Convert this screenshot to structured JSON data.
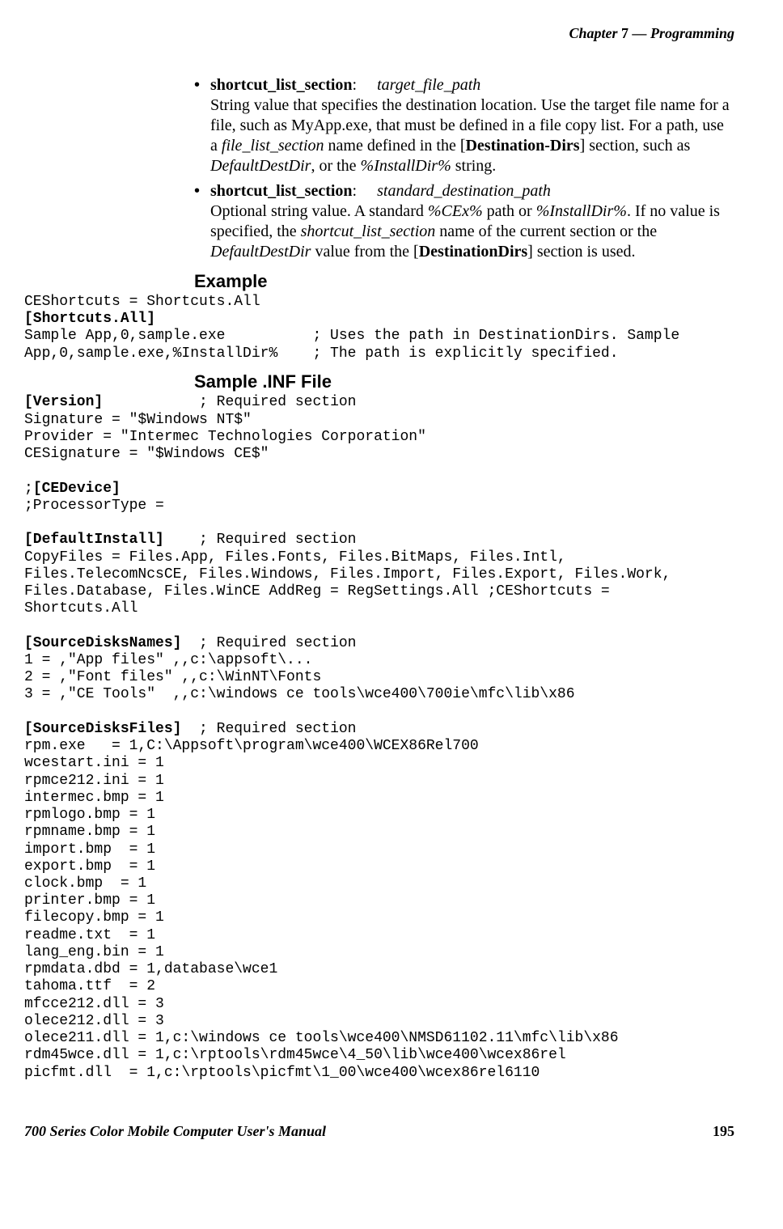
{
  "header": {
    "chapter_label": "Chapter",
    "chapter_num": "7",
    "dash": "—",
    "chapter_title": "Programming"
  },
  "bullets": [
    {
      "term": "shortcut_list_section",
      "colon": ":",
      "arg": "target_file_path",
      "body_parts": [
        {
          "t": "String value that specifies the destination location. Use the target file name for a file, such as MyApp.exe, that must be defined in a file copy list. For a path, use a ",
          "cls": ""
        },
        {
          "t": "file_list_section",
          "cls": "i"
        },
        {
          "t": " name defined in the [",
          "cls": ""
        },
        {
          "t": "Destination-Dirs",
          "cls": "b"
        },
        {
          "t": "] section, such as ",
          "cls": ""
        },
        {
          "t": "DefaultDestDir",
          "cls": "i"
        },
        {
          "t": ", or the ",
          "cls": ""
        },
        {
          "t": "%InstallDir%",
          "cls": "i"
        },
        {
          "t": " string.",
          "cls": ""
        }
      ]
    },
    {
      "term": "shortcut_list_section",
      "colon": ":",
      "arg": "standard_destination_path",
      "body_parts": [
        {
          "t": "Optional string value. A standard ",
          "cls": ""
        },
        {
          "t": "%CEx%",
          "cls": "i"
        },
        {
          "t": " path or ",
          "cls": ""
        },
        {
          "t": "%InstallDir%",
          "cls": "i"
        },
        {
          "t": ". If no value is specified, the ",
          "cls": ""
        },
        {
          "t": "shortcut_list_section",
          "cls": "i"
        },
        {
          "t": " name of the current section or the ",
          "cls": ""
        },
        {
          "t": "DefaultDestDir",
          "cls": "i"
        },
        {
          "t": " value from the [",
          "cls": ""
        },
        {
          "t": "DestinationDirs",
          "cls": "b"
        },
        {
          "t": "] section is used.",
          "cls": ""
        }
      ]
    }
  ],
  "subheads": {
    "example": "Example",
    "sample": "Sample .INF File"
  },
  "code_example": [
    {
      "t": "CEShortcuts = Shortcuts.All",
      "b": false
    },
    {
      "t": "[Shortcuts.All]",
      "b": true
    },
    {
      "t": "Sample App,0,sample.exe          ; Uses the path in DestinationDirs. Sample",
      "b": false
    },
    {
      "t": "App,0,sample.exe,%InstallDir%    ; The path is explicitly specified.",
      "b": false
    }
  ],
  "code_sample": [
    {
      "pre": "",
      "bold": "[Version]",
      "post": "           ; Required section"
    },
    {
      "pre": "Signature = \"$Windows NT$\"",
      "bold": "",
      "post": ""
    },
    {
      "pre": "Provider = \"Intermec Technologies Corporation\"",
      "bold": "",
      "post": ""
    },
    {
      "pre": "CESignature = \"$Windows CE$\"",
      "bold": "",
      "post": ""
    },
    {
      "pre": "",
      "bold": "",
      "post": ""
    },
    {
      "pre": ";",
      "bold": "[CEDevice]",
      "post": ""
    },
    {
      "pre": ";ProcessorType =",
      "bold": "",
      "post": ""
    },
    {
      "pre": "",
      "bold": "",
      "post": ""
    },
    {
      "pre": "",
      "bold": "[DefaultInstall]",
      "post": "    ; Required section"
    },
    {
      "pre": "CopyFiles = Files.App, Files.Fonts, Files.BitMaps, Files.Intl,",
      "bold": "",
      "post": ""
    },
    {
      "pre": "Files.TelecomNcsCE, Files.Windows, Files.Import, Files.Export, Files.Work,",
      "bold": "",
      "post": ""
    },
    {
      "pre": "Files.Database, Files.WinCE AddReg = RegSettings.All ;CEShortcuts =",
      "bold": "",
      "post": ""
    },
    {
      "pre": "Shortcuts.All",
      "bold": "",
      "post": ""
    },
    {
      "pre": "",
      "bold": "",
      "post": ""
    },
    {
      "pre": "",
      "bold": "[SourceDisksNames]",
      "post": "  ; Required section"
    },
    {
      "pre": "1 = ,\"App files\" ,,c:\\appsoft\\...",
      "bold": "",
      "post": ""
    },
    {
      "pre": "2 = ,\"Font files\" ,,c:\\WinNT\\Fonts",
      "bold": "",
      "post": ""
    },
    {
      "pre": "3 = ,\"CE Tools\"  ,,c:\\windows ce tools\\wce400\\700ie\\mfc\\lib\\x86",
      "bold": "",
      "post": ""
    },
    {
      "pre": "",
      "bold": "",
      "post": ""
    },
    {
      "pre": "",
      "bold": "[SourceDisksFiles]",
      "post": "  ; Required section"
    },
    {
      "pre": "rpm.exe   = 1,C:\\Appsoft\\program\\wce400\\WCEX86Rel700",
      "bold": "",
      "post": ""
    },
    {
      "pre": "wcestart.ini = 1",
      "bold": "",
      "post": ""
    },
    {
      "pre": "rpmce212.ini = 1",
      "bold": "",
      "post": ""
    },
    {
      "pre": "intermec.bmp = 1",
      "bold": "",
      "post": ""
    },
    {
      "pre": "rpmlogo.bmp = 1",
      "bold": "",
      "post": ""
    },
    {
      "pre": "rpmname.bmp = 1",
      "bold": "",
      "post": ""
    },
    {
      "pre": "import.bmp  = 1",
      "bold": "",
      "post": ""
    },
    {
      "pre": "export.bmp  = 1",
      "bold": "",
      "post": ""
    },
    {
      "pre": "clock.bmp  = 1",
      "bold": "",
      "post": ""
    },
    {
      "pre": "printer.bmp = 1",
      "bold": "",
      "post": ""
    },
    {
      "pre": "filecopy.bmp = 1",
      "bold": "",
      "post": ""
    },
    {
      "pre": "readme.txt  = 1",
      "bold": "",
      "post": ""
    },
    {
      "pre": "lang_eng.bin = 1",
      "bold": "",
      "post": ""
    },
    {
      "pre": "rpmdata.dbd = 1,database\\wce1",
      "bold": "",
      "post": ""
    },
    {
      "pre": "tahoma.ttf  = 2",
      "bold": "",
      "post": ""
    },
    {
      "pre": "mfcce212.dll = 3",
      "bold": "",
      "post": ""
    },
    {
      "pre": "olece212.dll = 3",
      "bold": "",
      "post": ""
    },
    {
      "pre": "olece211.dll = 1,c:\\windows ce tools\\wce400\\NMSD61102.11\\mfc\\lib\\x86",
      "bold": "",
      "post": ""
    },
    {
      "pre": "rdm45wce.dll = 1,c:\\rptools\\rdm45wce\\4_50\\lib\\wce400\\wcex86rel",
      "bold": "",
      "post": ""
    },
    {
      "pre": "picfmt.dll  = 1,c:\\rptools\\picfmt\\1_00\\wce400\\wcex86rel6110",
      "bold": "",
      "post": ""
    }
  ],
  "footer": {
    "title": "700 Series Color Mobile Computer User's Manual",
    "page": "195"
  }
}
